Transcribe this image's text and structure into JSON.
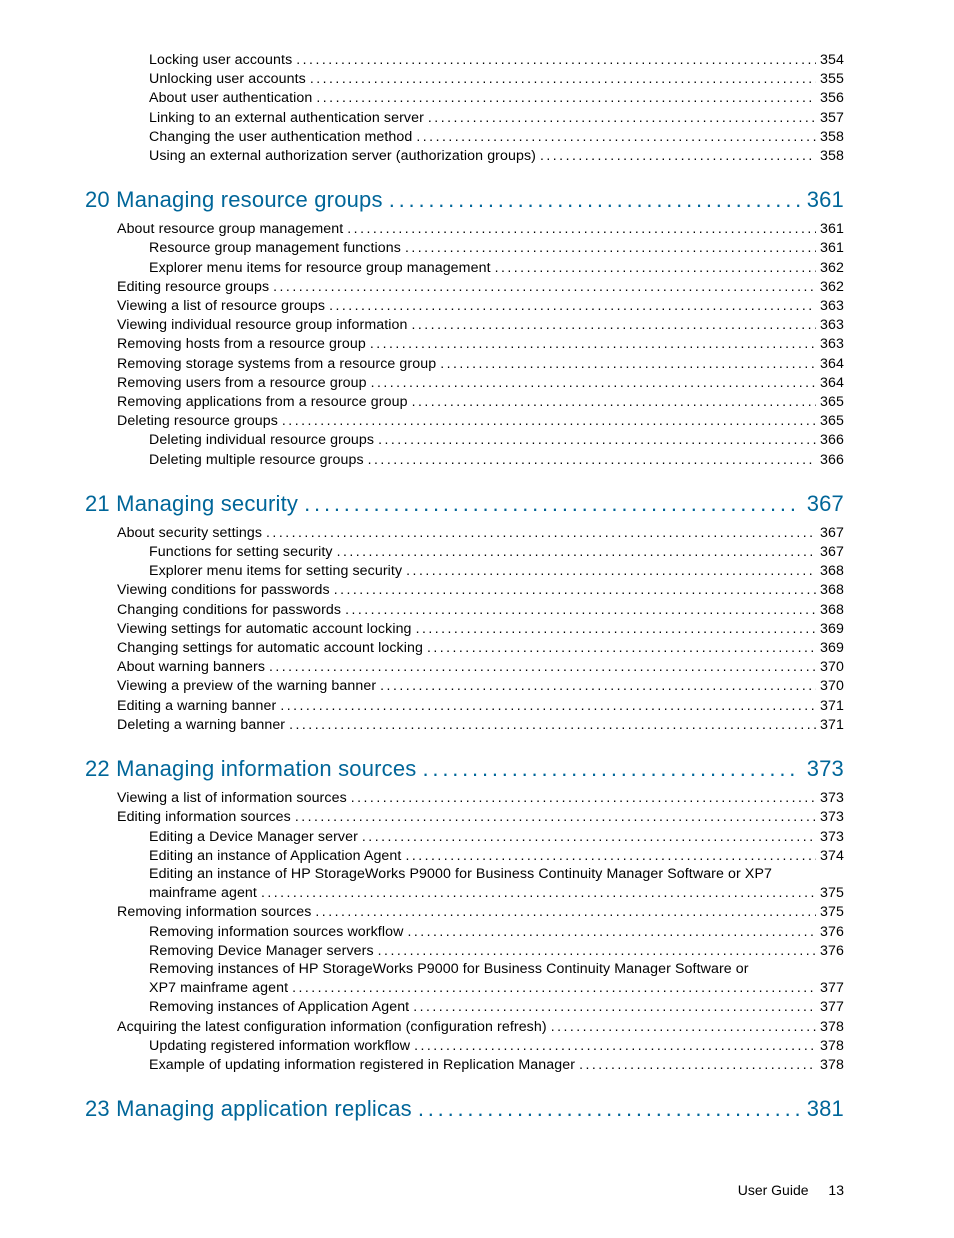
{
  "preEntries": [
    {
      "indent": 2,
      "title": "Locking user accounts",
      "page": "354"
    },
    {
      "indent": 2,
      "title": "Unlocking user accounts",
      "page": "355"
    },
    {
      "indent": 2,
      "title": "About user authentication",
      "page": "356"
    },
    {
      "indent": 2,
      "title": "Linking to an external authentication server",
      "page": "357"
    },
    {
      "indent": 2,
      "title": "Changing the user authentication method",
      "page": "358"
    },
    {
      "indent": 2,
      "title": "Using an external authorization server (authorization groups)",
      "page": "358"
    }
  ],
  "chapters": [
    {
      "num": "20",
      "title": "Managing resource groups",
      "page": "361",
      "entries": [
        {
          "indent": 1,
          "title": "About resource group management",
          "page": "361"
        },
        {
          "indent": 2,
          "title": "Resource group management functions",
          "page": "361"
        },
        {
          "indent": 2,
          "title": "Explorer menu items for resource group management",
          "page": "362"
        },
        {
          "indent": 1,
          "title": "Editing resource groups",
          "page": "362"
        },
        {
          "indent": 1,
          "title": "Viewing a list of resource groups",
          "page": "363"
        },
        {
          "indent": 1,
          "title": "Viewing individual resource group information",
          "page": "363"
        },
        {
          "indent": 1,
          "title": "Removing hosts from a resource group",
          "page": "363"
        },
        {
          "indent": 1,
          "title": "Removing storage systems from a resource group",
          "page": "364"
        },
        {
          "indent": 1,
          "title": "Removing users from a resource group",
          "page": "364"
        },
        {
          "indent": 1,
          "title": "Removing applications from a resource group",
          "page": "365"
        },
        {
          "indent": 1,
          "title": "Deleting resource groups",
          "page": "365"
        },
        {
          "indent": 2,
          "title": "Deleting individual resource groups",
          "page": "366"
        },
        {
          "indent": 2,
          "title": "Deleting multiple resource groups",
          "page": "366"
        }
      ]
    },
    {
      "num": "21",
      "title": "Managing security",
      "page": "367",
      "entries": [
        {
          "indent": 1,
          "title": "About security settings",
          "page": "367"
        },
        {
          "indent": 2,
          "title": "Functions for setting security",
          "page": "367"
        },
        {
          "indent": 2,
          "title": "Explorer menu items for setting security",
          "page": "368"
        },
        {
          "indent": 1,
          "title": "Viewing conditions for passwords",
          "page": "368"
        },
        {
          "indent": 1,
          "title": "Changing conditions for passwords",
          "page": "368"
        },
        {
          "indent": 1,
          "title": "Viewing settings for automatic account locking",
          "page": "369"
        },
        {
          "indent": 1,
          "title": "Changing settings for automatic account locking",
          "page": "369"
        },
        {
          "indent": 1,
          "title": "About warning banners",
          "page": "370"
        },
        {
          "indent": 1,
          "title": "Viewing a preview of the warning banner",
          "page": "370"
        },
        {
          "indent": 1,
          "title": "Editing a warning banner",
          "page": "371"
        },
        {
          "indent": 1,
          "title": "Deleting a warning banner",
          "page": "371"
        }
      ]
    },
    {
      "num": "22",
      "title": "Managing information sources",
      "page": "373",
      "entries": [
        {
          "indent": 1,
          "title": "Viewing a list of information sources",
          "page": "373"
        },
        {
          "indent": 1,
          "title": "Editing information sources",
          "page": "373"
        },
        {
          "indent": 2,
          "title": "Editing a Device Manager server",
          "page": "373"
        },
        {
          "indent": 2,
          "title": "Editing an instance of Application Agent",
          "page": "374"
        },
        {
          "indent": 2,
          "wrapTitle": "Editing an instance of HP StorageWorks P9000 for Business Continuity Manager Software or XP7",
          "contTitle": "mainframe agent",
          "page": "375"
        },
        {
          "indent": 1,
          "title": "Removing information sources",
          "page": "375"
        },
        {
          "indent": 2,
          "title": "Removing information sources workflow",
          "page": "376"
        },
        {
          "indent": 2,
          "title": "Removing Device Manager servers",
          "page": "376"
        },
        {
          "indent": 2,
          "wrapTitle": "Removing instances of HP StorageWorks P9000 for Business Continuity Manager Software or",
          "contTitle": "XP7 mainframe agent",
          "page": "377"
        },
        {
          "indent": 2,
          "title": "Removing instances of Application Agent",
          "page": "377"
        },
        {
          "indent": 1,
          "title": "Acquiring the latest configuration information (configuration refresh)",
          "page": "378"
        },
        {
          "indent": 2,
          "title": "Updating registered information workflow",
          "page": "378"
        },
        {
          "indent": 2,
          "title": "Example of updating information registered in Replication Manager",
          "page": "378"
        }
      ]
    },
    {
      "num": "23",
      "title": "Managing application replicas",
      "page": "381",
      "entries": []
    }
  ],
  "footer": {
    "label": "User Guide",
    "page": "13"
  }
}
